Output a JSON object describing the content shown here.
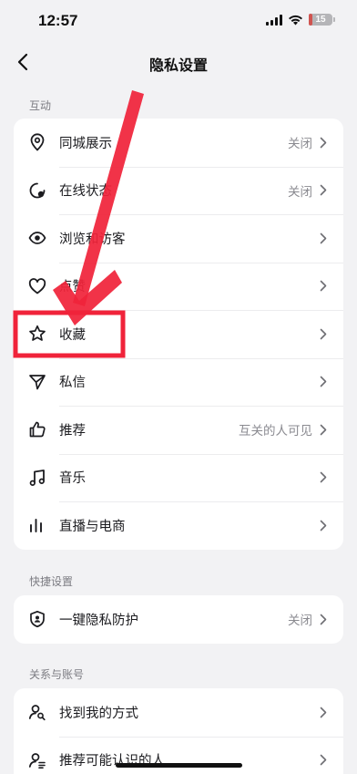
{
  "status_bar": {
    "time": "12:57",
    "battery_level": "15",
    "battery_color": "#d05450"
  },
  "nav": {
    "title": "隐私设置"
  },
  "sections": {
    "interaction": {
      "title": "互动",
      "rows": [
        {
          "label": "同城展示",
          "value": "关闭",
          "icon": "location-pin-icon"
        },
        {
          "label": "在线状态",
          "value": "关闭",
          "icon": "online-status-icon"
        },
        {
          "label": "浏览和访客",
          "value": "",
          "icon": "eye-icon"
        },
        {
          "label": "点赞",
          "value": "",
          "icon": "heart-icon"
        },
        {
          "label": "收藏",
          "value": "",
          "icon": "star-icon"
        },
        {
          "label": "私信",
          "value": "",
          "icon": "send-icon"
        },
        {
          "label": "推荐",
          "value": "互关的人可见",
          "icon": "thumbs-up-icon"
        },
        {
          "label": "音乐",
          "value": "",
          "icon": "music-note-icon"
        },
        {
          "label": "直播与电商",
          "value": "",
          "icon": "live-bars-icon"
        }
      ]
    },
    "quick": {
      "title": "快捷设置",
      "rows": [
        {
          "label": "一键隐私防护",
          "value": "关闭",
          "icon": "shield-user-icon"
        }
      ]
    },
    "account": {
      "title": "关系与账号",
      "rows": [
        {
          "label": "找到我的方式",
          "value": "",
          "icon": "find-user-icon"
        },
        {
          "label": "推荐可能认识的人",
          "value": "",
          "icon": "user-list-icon"
        }
      ]
    }
  },
  "annotation": {
    "color": "#f0233a"
  }
}
